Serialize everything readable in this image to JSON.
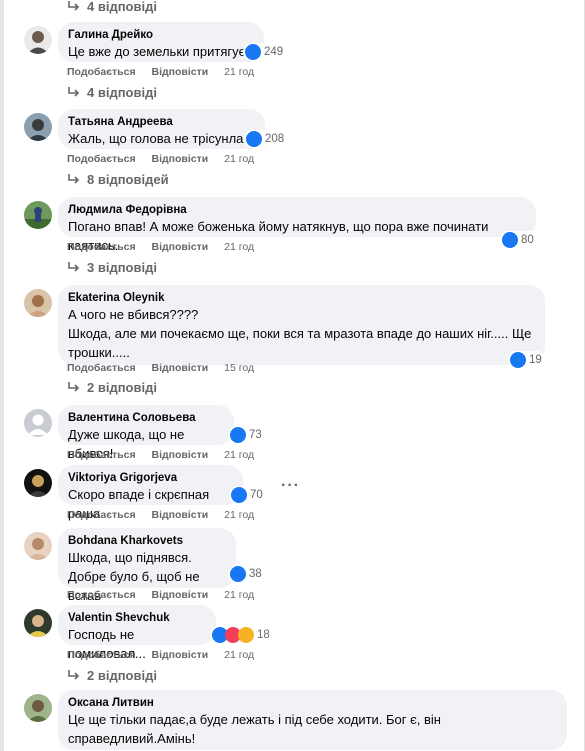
{
  "labels": {
    "like": "Подобається",
    "reply": "Відповісти"
  },
  "top_replies": "4 відповіді",
  "comments": [
    {
      "author": "Галина Дрейко",
      "lines": [
        "Це вже до земельки притягує."
      ],
      "reactions": "249",
      "time": "21 год",
      "replies": "4 відповіді"
    },
    {
      "author": "Татьяна Андреева",
      "lines": [
        "Жаль, що голова не трісунла..."
      ],
      "reactions": "208",
      "time": "21 год",
      "replies": "8 відповідей"
    },
    {
      "author": "Людмила Федорівна",
      "lines": [
        "Погано впав! А може боженька йому натякнув, що пора вже починати каятись."
      ],
      "reactions": "80",
      "time": "21 год",
      "replies": "3 відповіді"
    },
    {
      "author": "Ekaterina Oleynik",
      "lines": [
        "А чого не вбився????",
        "Шкода, але ми почекаємо ще, поки вся та мразота впаде до наших ніг..... Ще",
        "трошки....."
      ],
      "reactions": "19",
      "time": "15 год",
      "replies": "2 відповіді"
    },
    {
      "author": "Валентина Соловьева",
      "lines": [
        "Дуже шкода, що не вбився!"
      ],
      "reactions": "73",
      "time": "21 год",
      "replies": ""
    },
    {
      "author": "Viktoriya Grigorjeva",
      "lines": [
        "Скоро впаде і скрєпная раша"
      ],
      "reactions": "70",
      "time": "21 год",
      "replies": ""
    },
    {
      "author": "Bohdana Kharkovets",
      "lines": [
        "Шкода, що піднявся.",
        "Добре було б, щоб не встав"
      ],
      "reactions": "38",
      "time": "21 год",
      "replies": ""
    },
    {
      "author": "Valentin Shevchuk",
      "lines": [
        "Господь не помиловал..."
      ],
      "reactions": "18",
      "time": "21 год",
      "replies": "2 відповіді"
    },
    {
      "author": "Оксана Литвин",
      "lines": [
        "Це ще тільки падає,а буде лежать і під себе ходити. Бог є, він",
        "справедливий.Амінь!"
      ],
      "reactions": "",
      "time": "",
      "replies": ""
    }
  ],
  "more_icon": "ellipsis-icon",
  "colors": {
    "like_blue": "#1877f2",
    "love_red": "#f33e58",
    "wow_yellow": "#f7b125",
    "bubble": "#f0f2f5",
    "muted": "#65676b"
  }
}
